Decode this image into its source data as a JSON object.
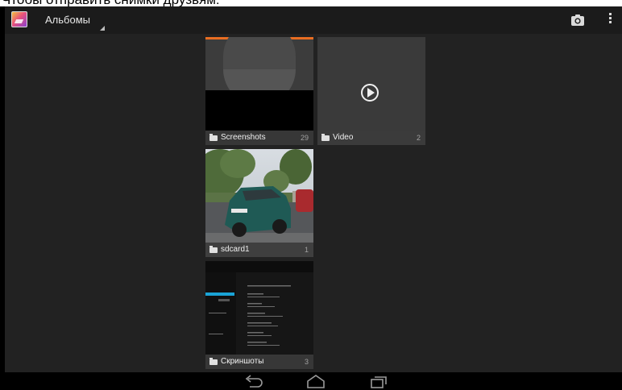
{
  "caption": {
    "text": "Чтобы отправить снимки друзьям:"
  },
  "actionbar": {
    "title": "Альбомы",
    "app_icon": "gallery-app-icon",
    "camera_icon": "camera-icon",
    "overflow_icon": "overflow-menu-icon"
  },
  "albums": [
    {
      "name": "Screenshots",
      "count": "29"
    },
    {
      "name": "Video",
      "count": "2"
    },
    {
      "name": "sdcard1",
      "count": "1"
    },
    {
      "name": "Скриншоты",
      "count": "3"
    }
  ],
  "navbar": {
    "back": "back-icon",
    "home": "home-icon",
    "recents": "recents-icon"
  },
  "colors": {
    "actionbar": "#1b1b1b",
    "content": "#222222",
    "accent": "#e96d22",
    "label_bar": "#3c3c3c"
  }
}
